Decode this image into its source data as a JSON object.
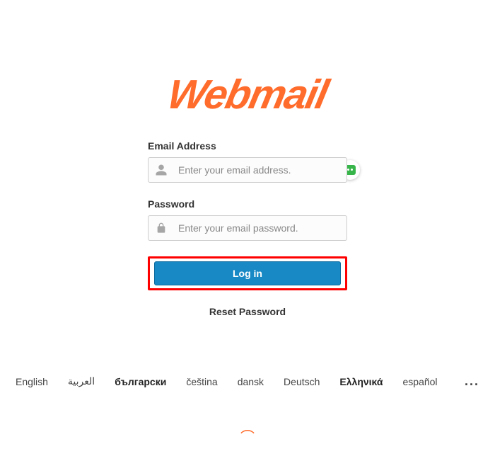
{
  "brand": {
    "title": "Webmail"
  },
  "form": {
    "email": {
      "label": "Email Address",
      "placeholder": "Enter your email address."
    },
    "password": {
      "label": "Password",
      "placeholder": "Enter your email password."
    },
    "login_label": "Log in",
    "reset_label": "Reset Password"
  },
  "languages": {
    "items": [
      "English",
      "العربية",
      "български",
      "čeština",
      "dansk",
      "Deutsch",
      "Ελληνικά",
      "español"
    ],
    "more": "..."
  },
  "colors": {
    "accent": "#ff6c2c",
    "button": "#1889c5",
    "highlight_border": "#ff0000"
  }
}
